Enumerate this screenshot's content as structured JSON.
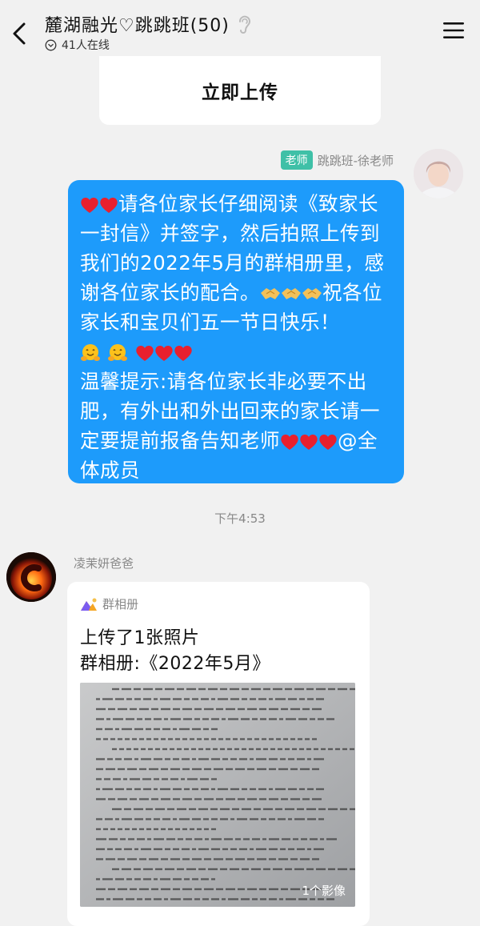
{
  "header": {
    "title": "麓湖融光♡跳跳班(50)",
    "online": "41人在线"
  },
  "upload_card": {
    "label": "立即上传"
  },
  "teacher_message": {
    "role_badge": "老师",
    "sender": "跳跳班-徐老师",
    "text_1": "请各位家长仔细阅读《致家长一封信》并签字，然后拍照上传到我们的2022年5月的群相册里，感谢各位家长的配合。",
    "text_2": "祝各位家长和宝贝们五一节日快乐！",
    "text_3": "温馨提示:请各位家长非必要不出肥，有外出和外出回来的家长请一定要提前报备告知老师",
    "text_4": "@全体成员"
  },
  "time_divider": "下午4:53",
  "album_message": {
    "sender": "凌茉妍爸爸",
    "card_label": "群相册",
    "line_1": "上传了1张照片",
    "line_2": "群相册:《2022年5月》",
    "photo_count": "1个影像"
  },
  "colors": {
    "bubble_blue": "#1d9bfb",
    "badge_green": "#3fc0a7",
    "background": "#f1f1f1"
  }
}
